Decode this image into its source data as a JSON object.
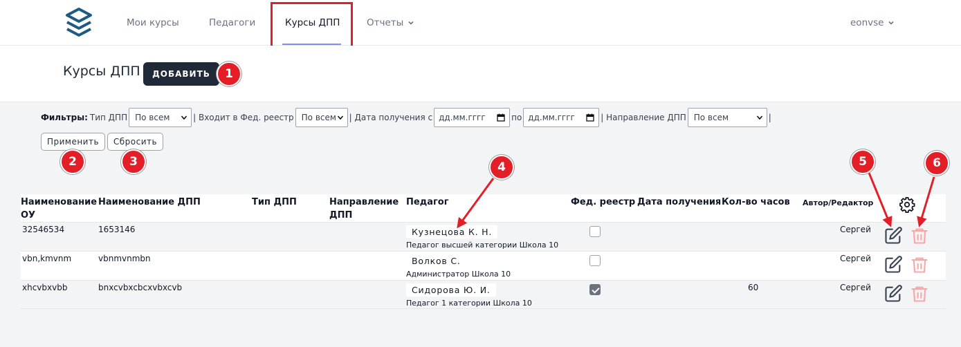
{
  "nav": {
    "items": [
      "Мои курсы",
      "Педагоги",
      "Курсы ДПП",
      "Отчеты"
    ],
    "user": "eonvse"
  },
  "header": {
    "title": "Курсы ДПП",
    "add_label": "ДОБАВИТЬ"
  },
  "filters": {
    "label": "Фильтры:",
    "type_label": "Тип ДПП",
    "type_value": "По всем",
    "fed_label": "| Входит в Фед. реестр",
    "fed_value": "По всем",
    "date_label": "| Дата получения с",
    "date_from": "дд.мм.гггг",
    "date_to_label": "по",
    "date_to": "дд.мм.гггг",
    "dir_label": "| Направление ДПП",
    "dir_value": "По всем",
    "sep": "|",
    "apply_label": "Применить",
    "reset_label": "Сбросить"
  },
  "table": {
    "headers": {
      "ou": "Наименование ОУ",
      "dpp": "Наименование ДПП",
      "type": "Тип ДПП",
      "direction": "Направление ДПП",
      "teacher": "Педагог",
      "fed": "Фед. реестр",
      "date": "Дата получения",
      "hours": "Кол-во часов",
      "author": "Автор/Редактор"
    },
    "rows": [
      {
        "ou": "32546534",
        "dpp": "1653146",
        "teacher": "Кузнецова К. Н.",
        "role": "Педагог высшей категории Школа 10",
        "fed": false,
        "hours": "",
        "author": "Сергей"
      },
      {
        "ou": "vbn,kmvnm",
        "dpp": "vbnmvnmbn",
        "teacher": "Волков С.",
        "role": "Администратор Школа 10",
        "fed": false,
        "hours": "",
        "author": "Сергей"
      },
      {
        "ou": "xhcvbxvbb",
        "dpp": "bnxcvbxcbcxvbxcvb",
        "teacher": "Сидорова Ю. И.",
        "role": "Педагог 1 категории Школа 10",
        "fed": true,
        "hours": "60",
        "author": "Сергей"
      }
    ]
  },
  "badges": [
    "1",
    "2",
    "3",
    "4",
    "5",
    "6"
  ],
  "icons": {
    "logo": "layers-icon",
    "settings": "gear-icon",
    "edit": "edit-icon",
    "delete": "trash-icon"
  },
  "colors": {
    "accent": "#818cf8",
    "annotation": "#e41e26",
    "dark_button": "#1f2937",
    "delete": "#fca5a5"
  }
}
